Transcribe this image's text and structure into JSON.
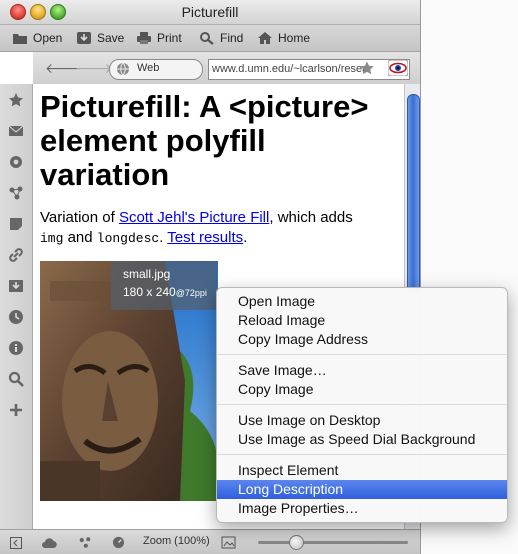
{
  "window": {
    "title": "Picturefill"
  },
  "toolbar": {
    "open": "Open",
    "save": "Save",
    "print": "Print",
    "find": "Find",
    "home": "Home"
  },
  "address": {
    "mode_label": "Web",
    "url": "www.d.umn.edu/~lcarlson/resea"
  },
  "page": {
    "heading": "Picturefill: A <picture> element polyfill variation",
    "intro_prefix": "Variation of ",
    "intro_link": "Scott Jehl's Picture Fill",
    "intro_mid": ", which adds ",
    "code_img": "img",
    "intro_and": " and ",
    "code_longdesc": "longdesc",
    "intro_dot": ". ",
    "test_link": "Test results",
    "end_dot": "."
  },
  "image_tooltip": {
    "name": "small.jpg",
    "dimensions": "180 x 240",
    "ppi": "@72ppi"
  },
  "statusbar": {
    "zoom": "Zoom (100%)",
    "zoom_level": 1.0
  },
  "context_menu": {
    "groups": [
      [
        "Open Image",
        "Reload Image",
        "Copy Image Address"
      ],
      [
        "Save Image…",
        "Copy Image"
      ],
      [
        "Use Image on Desktop",
        "Use Image as Speed Dial Background"
      ],
      [
        "Inspect Element",
        "Long Description",
        "Image Properties…"
      ]
    ],
    "highlighted": "Long Description"
  },
  "colors": {
    "link": "#0000ee",
    "menu_highlight": "#3a69e0",
    "scroll_thumb": "#3b6fd4"
  },
  "icons": {
    "sidebar": [
      "bookmarks-star-icon",
      "mail-icon",
      "settings-gear-icon",
      "unite-icon",
      "notes-icon",
      "links-icon",
      "downloads-icon",
      "history-clock-icon",
      "info-icon",
      "search-icon",
      "add-panel-icon"
    ]
  }
}
